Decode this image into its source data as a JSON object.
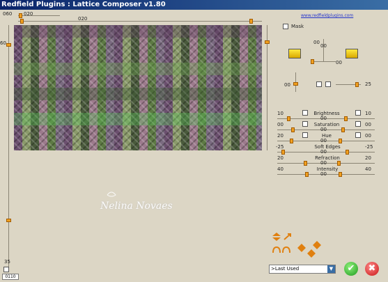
{
  "window": {
    "title": "Redfield Plugins : Lattice Composer v1.80"
  },
  "link": {
    "text": "www.redfieldplugins.com"
  },
  "top_controls": {
    "left_value_top": "060",
    "top_slider_value": "020",
    "top_slider_label": "020",
    "left_slider_value": "60",
    "left_bottom_value": "35",
    "corner_value": "0110"
  },
  "mask": {
    "label": "Mask"
  },
  "color_controls": {
    "val_a": "00",
    "val_b": "00",
    "val_c": "00",
    "spin_left": "00",
    "spin_right": "25"
  },
  "adjustments": [
    {
      "label": "Brightness",
      "left": "10",
      "right": "10",
      "center": "00"
    },
    {
      "label": "Saturation",
      "left": "00",
      "right": "00",
      "center": "00"
    },
    {
      "label": "Hue",
      "left": "20",
      "right": "00",
      "center": "00"
    },
    {
      "label": "Soft Edges",
      "left": "-25",
      "right": "-25",
      "center": "00"
    },
    {
      "label": "Refraction",
      "left": "20",
      "right": "20",
      "center": "00"
    },
    {
      "label": "Intensity",
      "left": "40",
      "right": "40",
      "center": "00"
    }
  ],
  "preset": {
    "selected": ">Last Used"
  },
  "buttons": {
    "ok": "✔",
    "cancel": "✖"
  },
  "signature": {
    "text": "Nelina Novaes"
  },
  "colors": {
    "accent": "#f0a020",
    "title_bar": "#0a246a",
    "ok": "#1e9a1e",
    "cancel": "#c81414"
  }
}
